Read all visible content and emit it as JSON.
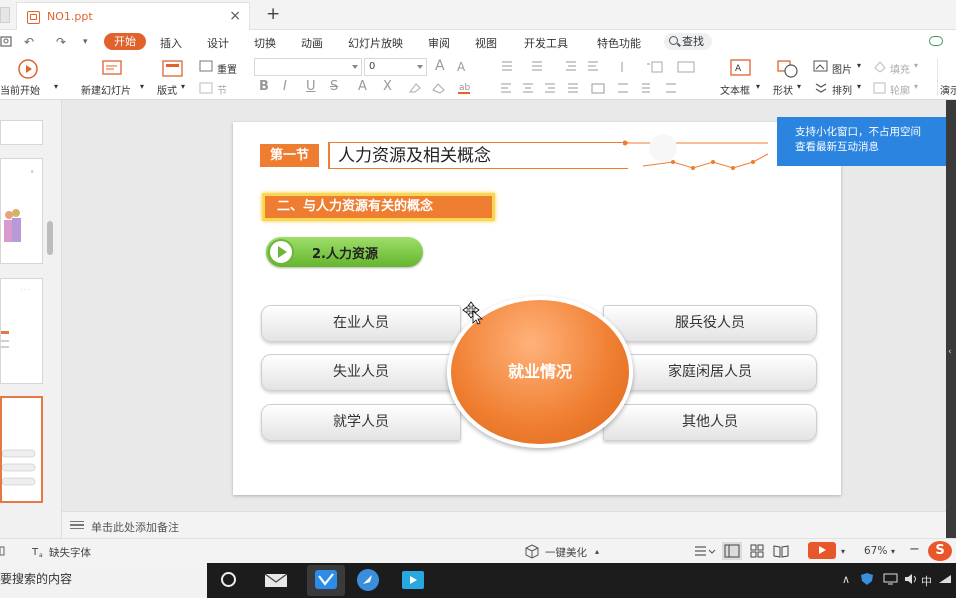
{
  "app": {
    "doc_tab": "NO1.ppt",
    "tab_close": "×",
    "new_tab": "+",
    "accent_color": "#e0622d"
  },
  "menu": {
    "items": [
      "开始",
      "插入",
      "设计",
      "切换",
      "动画",
      "幻灯片放映",
      "审阅",
      "视图",
      "开发工具",
      "特色功能"
    ],
    "search_label": "查找",
    "quick_access": [
      "↶",
      "↷",
      "▾"
    ]
  },
  "ribbon": {
    "from_current": "当前开始",
    "new_slide": "新建幻灯片",
    "layout": "版式",
    "reset": "重置",
    "section": "节",
    "font_name_value": "",
    "font_size_value": "0",
    "bold": "B",
    "italic": "I",
    "underline": "U",
    "strike": "S",
    "superscript": "A",
    "subscript": "X",
    "grow_font": "A",
    "shrink_font": "A",
    "textbox": "文本框",
    "shape": "形状",
    "picture": "图片",
    "fill": "填充",
    "arrange": "排列",
    "outline": "轮廓",
    "present": "演示"
  },
  "slide": {
    "section_badge": "第一节",
    "section_title": "人力资源及相关概念",
    "subtitle": "二、与人力资源有关的概念",
    "topic": "2.人力资源",
    "center_label": "就业情况",
    "left_items": [
      "在业人员",
      "失业人员",
      "就学人员"
    ],
    "right_items": [
      "服兵役人员",
      "家庭闲居人员",
      "其他人员"
    ],
    "accent_color": "#ee7d31"
  },
  "popup": {
    "line1": "支持小化窗口，不占用空间",
    "line2": "查看最新互动消息",
    "color": "#2a84e0"
  },
  "notes": {
    "placeholder": "单击此处添加备注"
  },
  "status": {
    "missing_font": "缺失字体",
    "beautify": "一键美化",
    "zoom": "67%",
    "zoom_minus": "−",
    "zoom_plus": "+"
  },
  "taskbar": {
    "search_text": "要搜索的内容",
    "tray_ime": "中"
  }
}
